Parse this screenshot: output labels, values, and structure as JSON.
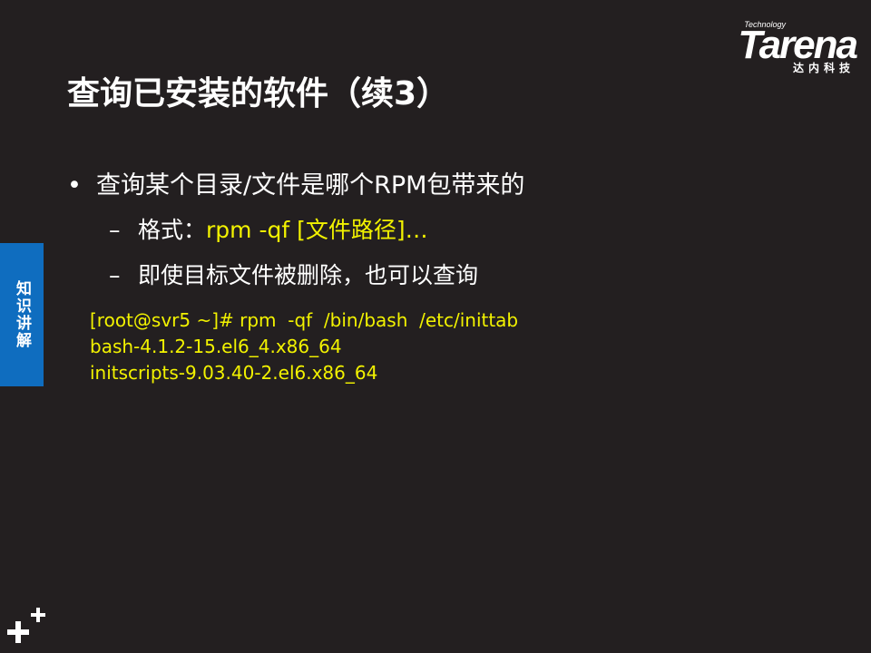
{
  "logo": {
    "brand": "Tarena",
    "tagline": "Technology",
    "chinese": "达内科技"
  },
  "title": "查询已安装的软件（续3）",
  "bullets": {
    "main": "查询某个目录/文件是哪个RPM包带来的",
    "marker": "•",
    "dash": "–",
    "sub1": {
      "label": "格式：",
      "command": "rpm   -qf  [文件路径]…"
    },
    "sub2": "即使目标文件被删除，也可以查询"
  },
  "code": {
    "line1": "[root@svr5 ~]# rpm  -qf  /bin/bash  /etc/inittab",
    "line2": "bash-4.1.2-15.el6_4.x86_64",
    "line3": "initscripts-9.03.40-2.el6.x86_64"
  },
  "side_tab": {
    "text": "知识讲解"
  },
  "colors": {
    "background": "#231f20",
    "highlight": "#f2f200",
    "tab": "#0f6dbf"
  },
  "icons": {
    "corner": "plus-mark-icon"
  }
}
